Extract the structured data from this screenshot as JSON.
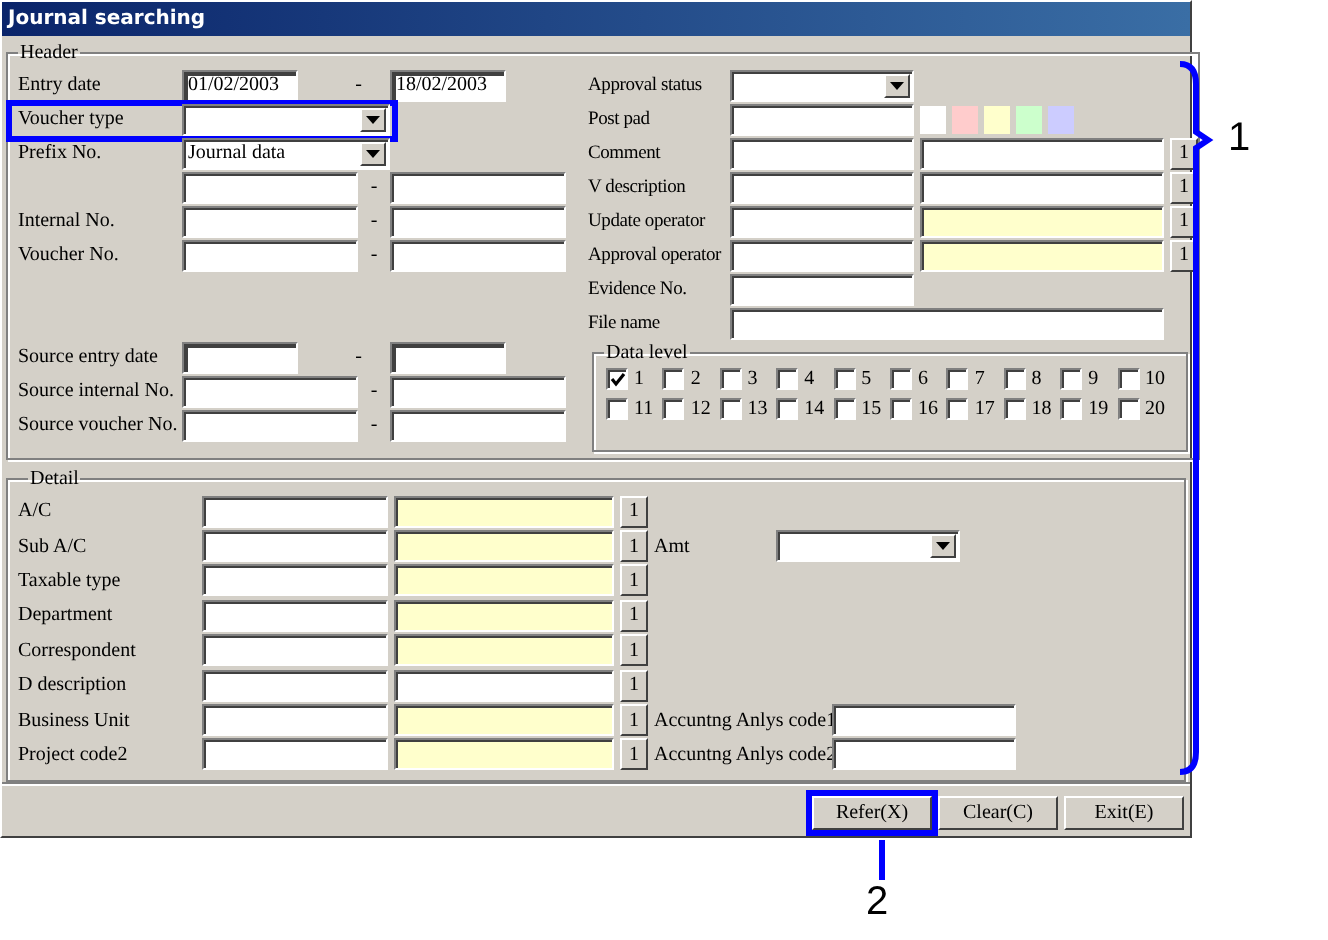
{
  "window": {
    "title": "Journal searching"
  },
  "header": {
    "label": "Header",
    "left_rows": [
      {
        "label": "Entry date",
        "kind": "date_range",
        "from": "01/02/2003",
        "separator": "-",
        "to": "18/02/2003"
      },
      {
        "label": "Voucher type",
        "kind": "select",
        "annotated": true
      },
      {
        "label": "Prefix No.",
        "kind": "select",
        "value": "Journal data"
      },
      {
        "kind": "range",
        "separator": "-"
      },
      {
        "label": "Internal No.",
        "kind": "range",
        "separator": "-"
      },
      {
        "label": "Voucher No.",
        "kind": "range",
        "separator": "-"
      }
    ],
    "source_rows": [
      {
        "label": "Source entry date",
        "kind": "date_range",
        "separator": "-"
      },
      {
        "label": "Source internal No.",
        "kind": "range",
        "separator": "-"
      },
      {
        "label": "Source voucher No.",
        "kind": "range",
        "separator": "-"
      }
    ],
    "right_rows": [
      {
        "label": "Approval status",
        "kind": "select"
      },
      {
        "label": "Post pad",
        "kind": "swatches",
        "swatches": [
          {
            "color": "#ffffff"
          },
          {
            "color": "#ffcccc"
          },
          {
            "color": "#ffffcc"
          },
          {
            "color": "#ccffcc"
          },
          {
            "color": "#ccccff"
          }
        ]
      },
      {
        "label": "Comment",
        "kind": "lookup",
        "readonly": false,
        "button": "1"
      },
      {
        "label": "V description",
        "kind": "lookup",
        "readonly": false,
        "button": "1"
      },
      {
        "label": "Update operator",
        "kind": "lookup",
        "readonly": true,
        "button": "1"
      },
      {
        "label": "Approval operator",
        "kind": "lookup",
        "readonly": true,
        "button": "1"
      },
      {
        "label": "Evidence No.",
        "kind": "field"
      },
      {
        "label": "File name",
        "kind": "wide"
      }
    ],
    "data_level": {
      "label": "Data level",
      "options": [
        {
          "label": "1",
          "checked": true
        },
        {
          "label": "2",
          "checked": false
        },
        {
          "label": "3",
          "checked": false
        },
        {
          "label": "4",
          "checked": false
        },
        {
          "label": "5",
          "checked": false
        },
        {
          "label": "6",
          "checked": false
        },
        {
          "label": "7",
          "checked": false
        },
        {
          "label": "8",
          "checked": false
        },
        {
          "label": "9",
          "checked": false
        },
        {
          "label": "10",
          "checked": false
        },
        {
          "label": "11",
          "checked": false
        },
        {
          "label": "12",
          "checked": false
        },
        {
          "label": "13",
          "checked": false
        },
        {
          "label": "14",
          "checked": false
        },
        {
          "label": "15",
          "checked": false
        },
        {
          "label": "16",
          "checked": false
        },
        {
          "label": "17",
          "checked": false
        },
        {
          "label": "18",
          "checked": false
        },
        {
          "label": "19",
          "checked": false
        },
        {
          "label": "20",
          "checked": false
        }
      ]
    }
  },
  "detail": {
    "label": "Detail",
    "rows": [
      {
        "label": "A/C",
        "readonly": true,
        "button": "1"
      },
      {
        "label": "Sub A/C",
        "readonly": true,
        "button": "1",
        "extra": {
          "kind": "select",
          "label": "Amt"
        }
      },
      {
        "label": "Taxable type",
        "readonly": true,
        "button": "1"
      },
      {
        "label": "Department",
        "readonly": true,
        "button": "1"
      },
      {
        "label": "Correspondent",
        "readonly": true,
        "button": "1"
      },
      {
        "label": "D description",
        "readonly": false,
        "button": "1"
      },
      {
        "label": "Business Unit",
        "readonly": true,
        "button": "1",
        "extra": {
          "kind": "text",
          "label": "Accuntng Anlys code1"
        }
      },
      {
        "label": "Project code2",
        "readonly": true,
        "button": "1",
        "extra": {
          "kind": "text",
          "label": "Accuntng Anlys code2"
        }
      }
    ]
  },
  "buttons": [
    {
      "label": "Refer(X)",
      "annotated": true
    },
    {
      "label": "Clear(C)",
      "annotated": false
    },
    {
      "label": "Exit(E)",
      "annotated": false
    }
  ],
  "annotations": [
    {
      "kind": "bracket",
      "label": "1"
    },
    {
      "kind": "pointer",
      "label": "2"
    }
  ]
}
